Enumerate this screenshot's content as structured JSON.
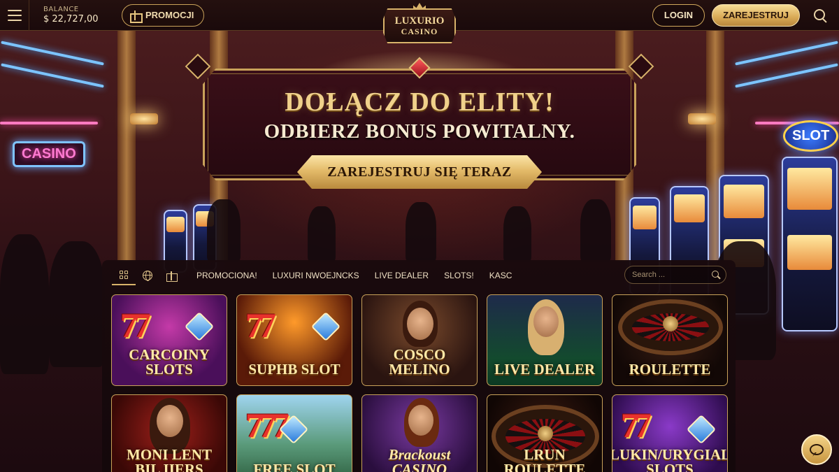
{
  "header": {
    "balance_label": "BALANCE",
    "balance_value": "$ 22,727,00",
    "promo_label": "PROMOCJI",
    "logo_line1": "LUXURIO",
    "logo_line2": "CASINO",
    "login_label": "LOGIN",
    "register_label": "ZAREJESTRUJ"
  },
  "hero": {
    "title": "DOŁĄCZ DO ELITY!",
    "subtitle": "ODBIERZ BONUS POWITALNY.",
    "cta_label": "ZAREJESTRUJ SIĘ TERAZ",
    "neon_sign": "CASINO",
    "slot_sign": "SLOT"
  },
  "nav": {
    "tabs": [
      "PROMOCIONA!",
      "LUXURI NWOEJNCKS",
      "LIVE DEALER",
      "SLOTS!",
      "KASC"
    ],
    "search_placeholder": "Search ..."
  },
  "games": [
    {
      "title": "CARCOINY SLOTS",
      "theme": "slots"
    },
    {
      "title": "SUPHB SLOT",
      "theme": "slots"
    },
    {
      "title": "COSCO MELINO",
      "theme": "lady"
    },
    {
      "title": "LIVE DEALER",
      "theme": "dealer"
    },
    {
      "title": "ROULETTE",
      "theme": "roulette"
    },
    {
      "title": "MONI LENT BIL IIERS",
      "theme": "lady"
    },
    {
      "title": "FREE SLOT",
      "theme": "slots"
    },
    {
      "title": "Brackoust CASINO",
      "theme": "cards"
    },
    {
      "title": "LRUN ROULETTE",
      "theme": "roulette"
    },
    {
      "title": "LUKIN/URYGIAL SLOTS",
      "theme": "slots"
    }
  ],
  "colors": {
    "accent_gold": "#d8b36a",
    "background": "#1a0c10",
    "banner": "#2f0c14"
  }
}
